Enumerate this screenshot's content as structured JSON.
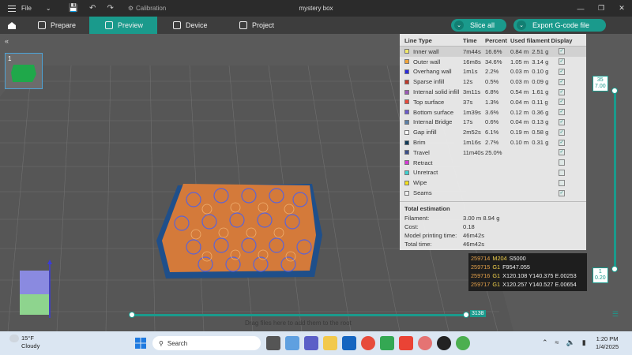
{
  "titlebar": {
    "file_label": "File",
    "calibration_label": "Calibration",
    "window_title": "mystery box"
  },
  "nav": {
    "tabs": [
      {
        "label": "Prepare"
      },
      {
        "label": "Preview"
      },
      {
        "label": "Device"
      },
      {
        "label": "Project"
      }
    ],
    "active_tab": "Preview",
    "slice_label": "Slice all",
    "export_label": "Export G-code file"
  },
  "accent_color": "#1a9a8c",
  "plate_thumb": {
    "number": "1"
  },
  "legend": {
    "headers": {
      "line_type": "Line Type",
      "time": "Time",
      "percent": "Percent",
      "used": "Used filament",
      "display": "Display"
    },
    "rows": [
      {
        "color": "#f2e86a",
        "type": "Inner wall",
        "time": "7m44s",
        "pct": "16.6%",
        "m": "0.84 m",
        "g": "2.51 g"
      },
      {
        "color": "#f2a53a",
        "type": "Outer wall",
        "time": "16m8s",
        "pct": "34.6%",
        "m": "1.05 m",
        "g": "3.14 g"
      },
      {
        "color": "#2b2be0",
        "type": "Overhang wall",
        "time": "1m1s",
        "pct": "2.2%",
        "m": "0.03 m",
        "g": "0.10 g"
      },
      {
        "color": "#c0392b",
        "type": "Sparse infill",
        "time": "12s",
        "pct": "0.5%",
        "m": "0.03 m",
        "g": "0.09 g"
      },
      {
        "color": "#9b59b6",
        "type": "Internal solid infill",
        "time": "3m11s",
        "pct": "6.8%",
        "m": "0.54 m",
        "g": "1.61 g"
      },
      {
        "color": "#e84a3c",
        "type": "Top surface",
        "time": "37s",
        "pct": "1.3%",
        "m": "0.04 m",
        "g": "0.11 g"
      },
      {
        "color": "#6a5acd",
        "type": "Bottom surface",
        "time": "1m39s",
        "pct": "3.6%",
        "m": "0.12 m",
        "g": "0.36 g"
      },
      {
        "color": "#5b7fa6",
        "type": "Internal Bridge",
        "time": "17s",
        "pct": "0.6%",
        "m": "0.04 m",
        "g": "0.13 g"
      },
      {
        "color": "#ffffff",
        "type": "Gap infill",
        "time": "2m52s",
        "pct": "6.1%",
        "m": "0.19 m",
        "g": "0.58 g"
      },
      {
        "color": "#0f3a58",
        "type": "Brim",
        "time": "1m16s",
        "pct": "2.7%",
        "m": "0.10 m",
        "g": "0.31 g"
      },
      {
        "color": "#3b4f8a",
        "type": "Travel",
        "time": "11m40s",
        "pct": "25.0%",
        "m": "",
        "g": ""
      },
      {
        "color": "#d63ad6",
        "type": "Retract",
        "time": "",
        "pct": "",
        "m": "",
        "g": ""
      },
      {
        "color": "#3fd1d1",
        "type": "Unretract",
        "time": "",
        "pct": "",
        "m": "",
        "g": ""
      },
      {
        "color": "#f5e11a",
        "type": "Wipe",
        "time": "",
        "pct": "",
        "m": "",
        "g": ""
      },
      {
        "color": "#f0f0f0",
        "type": "Seams",
        "time": "",
        "pct": "",
        "m": "",
        "g": ""
      }
    ],
    "total_heading": "Total estimation",
    "totals": [
      {
        "k": "Filament:",
        "v": "3.00 m    8.94 g"
      },
      {
        "k": "Cost:",
        "v": "0.18"
      },
      {
        "k": "Model printing time:",
        "v": "46m42s"
      },
      {
        "k": "Total time:",
        "v": "46m42s"
      }
    ]
  },
  "gcode": [
    {
      "n": "259714",
      "cmd": "M204",
      "rest": "S5000"
    },
    {
      "n": "259715",
      "cmd": "G1",
      "rest": "F9547.055"
    },
    {
      "n": "259716",
      "cmd": "G1",
      "rest": "X120.108 Y140.375 E.00253"
    },
    {
      "n": "259717",
      "cmd": "G1",
      "rest": "X120.257 Y140.527 E.00654"
    }
  ],
  "layer_slider": {
    "top_layer": "35",
    "top_height": "7.00",
    "bottom_layer": "1",
    "bottom_height": "0.20"
  },
  "move_slider": {
    "value": "3138"
  },
  "hint_text": "Drag files here to add them to the root",
  "taskbar": {
    "temp": "15°F",
    "condition": "Cloudy",
    "search_placeholder": "Search",
    "time": "1:20 PM",
    "date": "1/4/2025"
  }
}
